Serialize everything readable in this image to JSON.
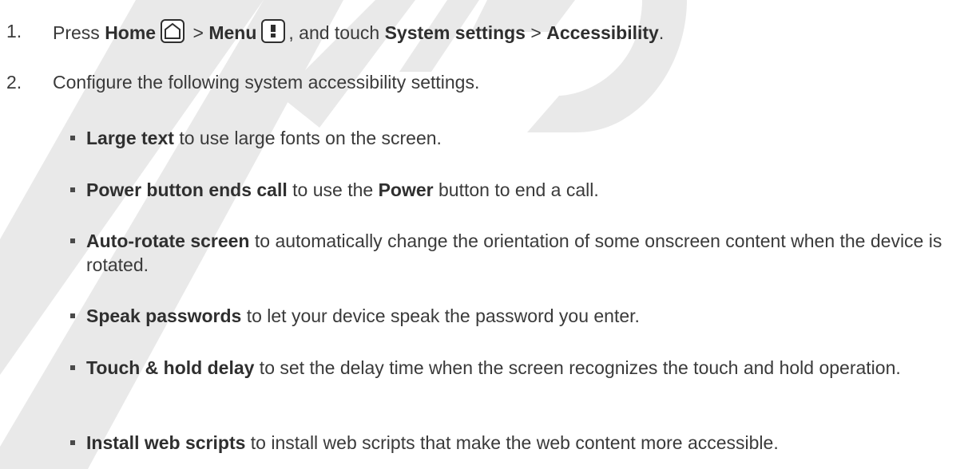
{
  "steps": [
    {
      "number": "1.",
      "press": "Press",
      "home_label": "Home",
      "home_icon": "home-button-icon",
      "separator1": ">",
      "menu_label": "Menu",
      "menu_icon": "menu-button-icon",
      "touch_text": ", and touch",
      "system_settings": "System settings",
      "separator2": ">",
      "accessibility": "Accessibility",
      "end": "."
    },
    {
      "number": "2.",
      "text": "Configure the following system accessibility settings."
    }
  ],
  "bullets": [
    {
      "term": "Large text",
      "desc": " to use large fonts on the screen."
    },
    {
      "term": "Power button ends call",
      "desc_a": " to use the ",
      "term_b": "Power",
      "desc_b": " button to end a call."
    },
    {
      "term": "Auto-rotate screen",
      "desc": " to automatically change the orientation of some onscreen content when the device is rotated."
    },
    {
      "term": "Speak passwords",
      "desc": " to let your device speak the password you enter."
    },
    {
      "term": "Touch & hold delay",
      "desc": " to set the delay time when the screen recognizes the touch and hold operation."
    },
    {
      "term": "Install web scripts",
      "desc": " to install web scripts that make the web content more accessible."
    }
  ],
  "colors": {
    "text": "#3a3a3a",
    "watermark": "#e6e6e6"
  }
}
